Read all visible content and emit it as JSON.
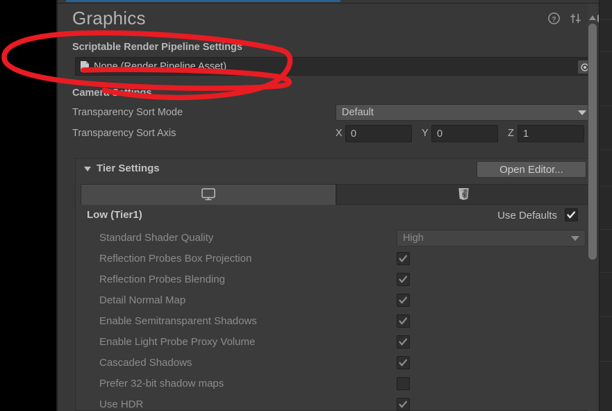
{
  "window": {
    "title": "Graphics",
    "header_icons": [
      {
        "name": "help-icon",
        "glyph": "?"
      },
      {
        "name": "preset-icon",
        "glyph": "sliders"
      },
      {
        "name": "gear-icon",
        "glyph": "gear"
      }
    ]
  },
  "srp": {
    "section_label": "Scriptable Render Pipeline Settings",
    "asset_value": "None (Render Pipeline Asset)",
    "picker_icon": "object-picker-icon"
  },
  "camera": {
    "section_label": "Camera Settings",
    "sort_mode": {
      "label": "Transparency Sort Mode",
      "value": "Default"
    },
    "sort_axis": {
      "label": "Transparency Sort Axis",
      "x_label": "X",
      "x_value": "0",
      "y_label": "Y",
      "y_value": "0",
      "z_label": "Z",
      "z_value": "1"
    }
  },
  "tier_settings": {
    "title": "Tier Settings",
    "open_editor_label": "Open Editor...",
    "tabs": [
      {
        "name": "standalone",
        "icon": "monitor-icon",
        "active": true
      },
      {
        "name": "webgl",
        "icon": "html5-icon",
        "active": false
      }
    ],
    "tier_name": "Low (Tier1)",
    "use_defaults_label": "Use Defaults",
    "use_defaults_checked": true,
    "properties": [
      {
        "label": "Standard Shader Quality",
        "type": "dropdown",
        "value": "High",
        "disabled": true
      },
      {
        "label": "Reflection Probes Box Projection",
        "type": "checkbox",
        "checked": true,
        "disabled": true
      },
      {
        "label": "Reflection Probes Blending",
        "type": "checkbox",
        "checked": true,
        "disabled": true
      },
      {
        "label": "Detail Normal Map",
        "type": "checkbox",
        "checked": true,
        "disabled": true
      },
      {
        "label": "Enable Semitransparent Shadows",
        "type": "checkbox",
        "checked": true,
        "disabled": true
      },
      {
        "label": "Enable Light Probe Proxy Volume",
        "type": "checkbox",
        "checked": true,
        "disabled": true
      },
      {
        "label": "Cascaded Shadows",
        "type": "checkbox",
        "checked": true,
        "disabled": true
      },
      {
        "label": "Prefer 32-bit shadow maps",
        "type": "checkbox",
        "checked": false,
        "disabled": true
      },
      {
        "label": "Use HDR",
        "type": "checkbox",
        "checked": true,
        "disabled": true
      }
    ]
  },
  "annotation": {
    "shape": "ellipse",
    "color": "#e81c22",
    "target": "Scriptable Render Pipeline Settings field"
  },
  "colors": {
    "window_bg": "#383838",
    "panel_bg": "#3b3b3b",
    "field_bg": "#2a2a2a",
    "tab_accent": "#2b5f8e",
    "text": "#b4b4b4",
    "text_dim": "#8c8c8c",
    "annotation_red": "#e81c22"
  }
}
